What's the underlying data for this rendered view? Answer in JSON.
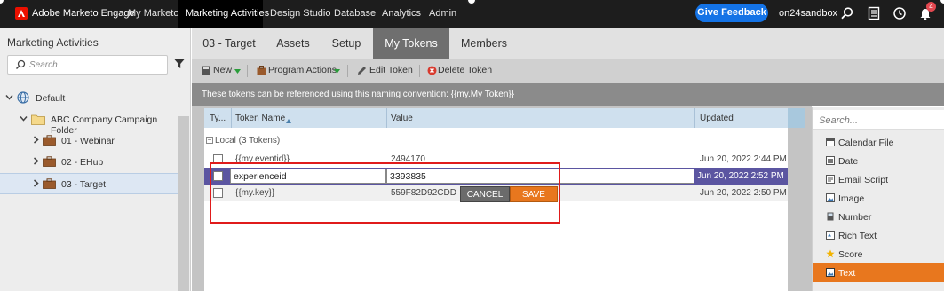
{
  "topnav": {
    "brand": "Adobe Marketo Engage",
    "items": [
      "My Marketo",
      "Marketing Activities",
      "Design Studio",
      "Database",
      "Analytics",
      "Admin"
    ],
    "feedback": "Give Feedback",
    "sandbox": "on24sandbox",
    "notification_count": "4",
    "accent": "#1473e6"
  },
  "sidebar": {
    "title": "Marketing Activities",
    "search_placeholder": "Search",
    "tree": [
      {
        "label": "Default"
      },
      {
        "label": "ABC Company Campaign Folder"
      },
      {
        "label": "01 - Webinar"
      },
      {
        "label": "02 - EHub"
      },
      {
        "label": "03 - Target"
      }
    ]
  },
  "tabs": [
    "03 - Target",
    "Assets",
    "Setup",
    "My Tokens",
    "Members"
  ],
  "active_tab": "My Tokens",
  "toolbar": {
    "new": "New",
    "program_actions": "Program Actions",
    "edit_token": "Edit Token",
    "delete_token": "Delete Token"
  },
  "info": "These tokens can be referenced using this naming convention: {{my.My Token}}",
  "grid": {
    "headers": [
      "Ty...",
      "Token Name",
      "Value",
      "Updated"
    ],
    "group": "Local (3 Tokens)",
    "rows": [
      {
        "name": "{{my.eventid}}",
        "value": "2494170",
        "updated": "Jun 20, 2022 2:44 PM"
      },
      {
        "name": "experienceid",
        "value": "3393835",
        "updated": "Jun 20, 2022 2:52 PM"
      },
      {
        "name": "{{my.key}}",
        "value": "559F82D92CDD",
        "updated": "Jun 20, 2022 2:50 PM"
      }
    ],
    "cancel": "CANCEL",
    "save": "SAVE"
  },
  "token_types": {
    "search_placeholder": "Search...",
    "items": [
      "Calendar File",
      "Date",
      "Email Script",
      "Image",
      "Number",
      "Rich Text",
      "Score",
      "Text"
    ],
    "active": "Text",
    "active_color": "#e8771e"
  }
}
